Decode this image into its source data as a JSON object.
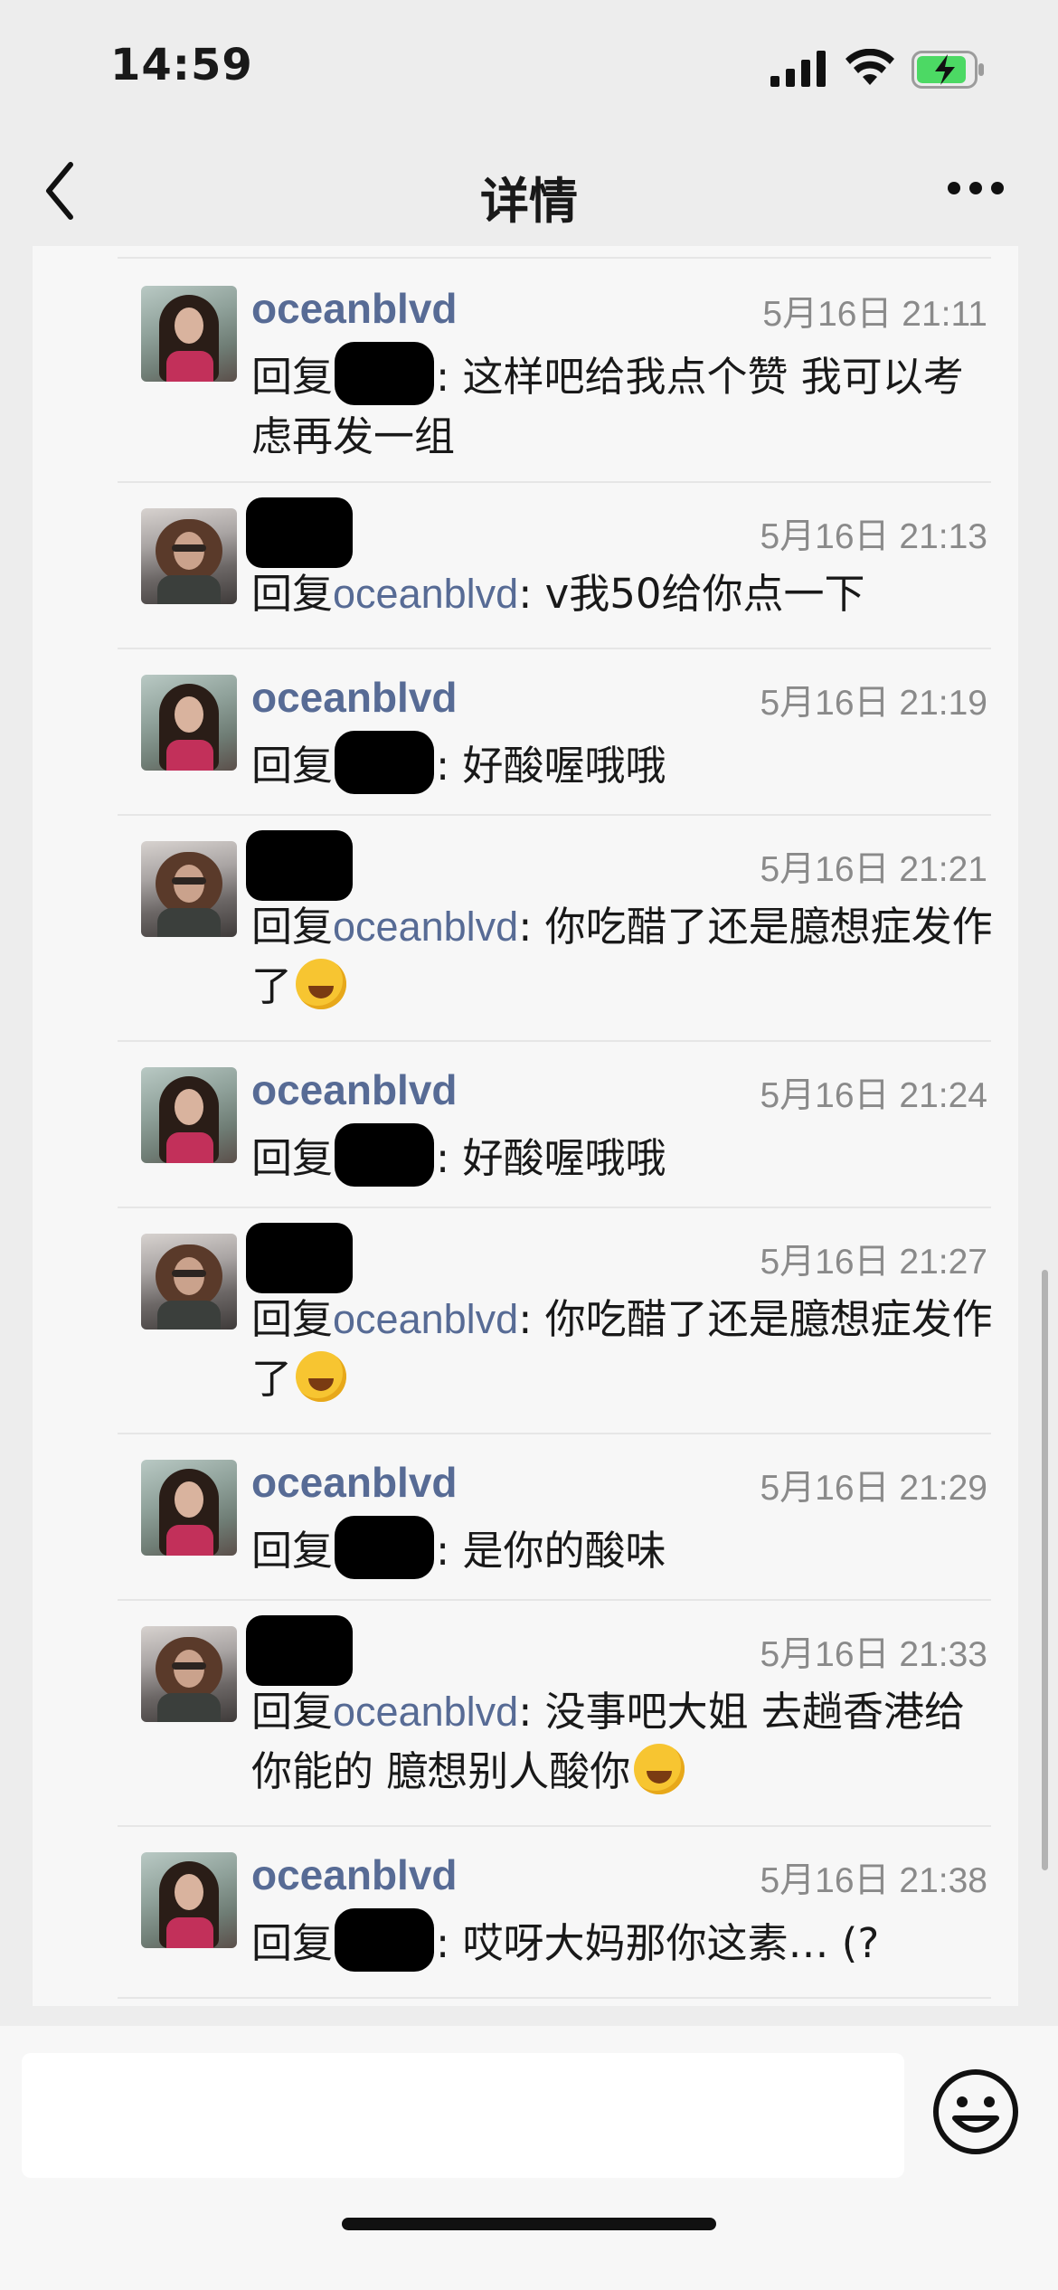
{
  "status_bar": {
    "time": "14:59"
  },
  "nav": {
    "title": "详情"
  },
  "comments": [
    {
      "author": "oceanblvd",
      "time": "5月16日 21:11",
      "reply_prefix": "回复",
      "text": ": 这样吧给我点个赞 我可以考虑再发一组",
      "emoji": false
    },
    {
      "author": "",
      "time": "5月16日 21:13",
      "reply_prefix": "回复",
      "reply_target": "oceanblvd",
      "text": ": v我50给你点一下",
      "emoji": false
    },
    {
      "author": "oceanblvd",
      "time": "5月16日 21:19",
      "reply_prefix": "回复",
      "text": ": 好酸喔哦哦",
      "emoji": false
    },
    {
      "author": "",
      "time": "5月16日 21:21",
      "reply_prefix": "回复",
      "reply_target": "oceanblvd",
      "text": ": 你吃醋了还是臆想症发作了",
      "emoji": true
    },
    {
      "author": "oceanblvd",
      "time": "5月16日 21:24",
      "reply_prefix": "回复",
      "text": ": 好酸喔哦哦",
      "emoji": false
    },
    {
      "author": "",
      "time": "5月16日 21:27",
      "reply_prefix": "回复",
      "reply_target": "oceanblvd",
      "text": ": 你吃醋了还是臆想症发作了",
      "emoji": true
    },
    {
      "author": "oceanblvd",
      "time": "5月16日 21:29",
      "reply_prefix": "回复",
      "text": ": 是你的酸味",
      "emoji": false
    },
    {
      "author": "",
      "time": "5月16日 21:33",
      "reply_prefix": "回复",
      "reply_target": "oceanblvd",
      "text": ": 没事吧大姐 去趟香港给你能的 臆想别人酸你",
      "emoji": true
    },
    {
      "author": "oceanblvd",
      "time": "5月16日 21:38",
      "reply_prefix": "回复",
      "text": ": 哎呀大妈那你这素… (?",
      "emoji": false
    }
  ],
  "input": {
    "placeholder": ""
  },
  "icons": {
    "back": "chevron-left-icon",
    "more": "more-dots-icon",
    "emoji": "smiley-icon",
    "signal": "signal-icon",
    "wifi": "wifi-icon",
    "battery": "battery-charging-icon"
  },
  "colors": {
    "link_blue": "#576b95",
    "battery_green": "#4cd964",
    "panel_bg": "#f7f7f7"
  }
}
